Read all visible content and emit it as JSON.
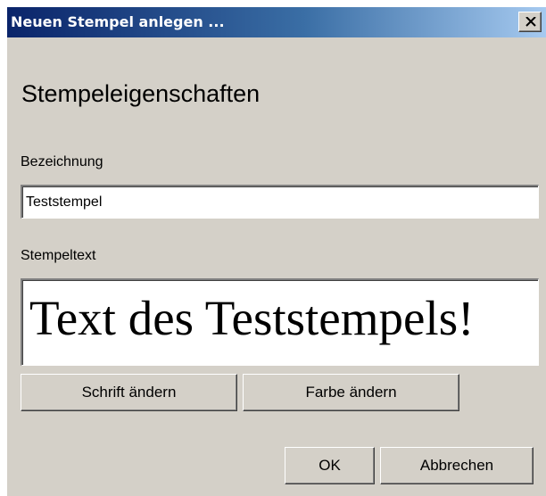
{
  "window": {
    "title": "Neuen Stempel anlegen ..."
  },
  "dialog": {
    "heading": "Stempeleigenschaften",
    "name_label": "Bezeichnung",
    "name_value": "Teststempel",
    "stamp_text_label": "Stempeltext",
    "stamp_text_preview": "Text des Teststempels!"
  },
  "buttons": {
    "change_font": "Schrift ändern",
    "change_color": "Farbe ändern",
    "ok": "OK",
    "cancel": "Abbrechen"
  },
  "icons": {
    "close": "close-icon"
  },
  "colors": {
    "titlebar_start": "#0a246a",
    "titlebar_end": "#a6caf0",
    "dialog_background": "#d4d0c8"
  }
}
